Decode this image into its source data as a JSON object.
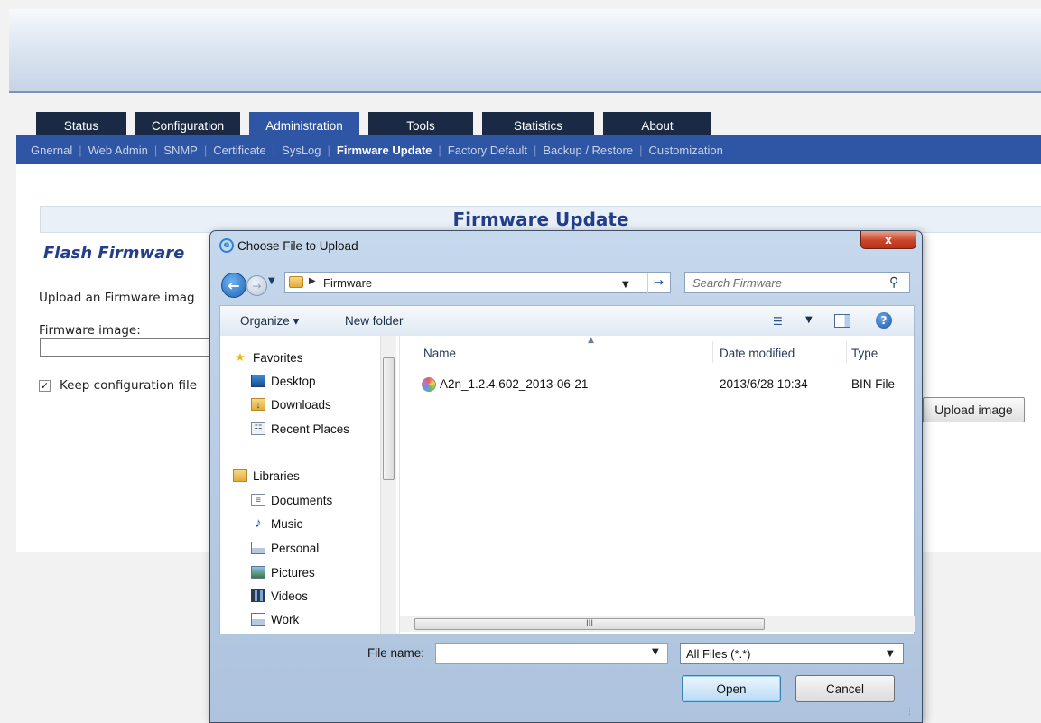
{
  "tabs": [
    "Status",
    "Configuration",
    "Administration",
    "Tools",
    "Statistics",
    "About"
  ],
  "active_tab": "Administration",
  "subnav": [
    "Gnernal",
    "Web Admin",
    "SNMP",
    "Certificate",
    "SysLog",
    "Firmware Update",
    "Factory Default",
    "Backup / Restore",
    "Customization"
  ],
  "page": {
    "section_title": "Firmware Update",
    "flash_title": "Flash Firmware",
    "upload_desc": "Upload an Firmware imag",
    "fw_label": "Firmware image:",
    "keep_label": "Keep configuration file",
    "keep_checked": "✓",
    "upload_button": "Upload image"
  },
  "dialog": {
    "title": "Choose File to Upload",
    "close": "x",
    "address": "Firmware",
    "search_placeholder": "Search Firmware",
    "organize": "Organize ▾",
    "new_folder": "New folder",
    "nav": {
      "favorites": "Favorites",
      "desktop": "Desktop",
      "downloads": "Downloads",
      "recent": "Recent Places",
      "libraries": "Libraries",
      "documents": "Documents",
      "music": "Music",
      "personal": "Personal",
      "pictures": "Pictures",
      "videos": "Videos",
      "work": "Work"
    },
    "columns": {
      "name": "Name",
      "date": "Date modified",
      "type": "Type"
    },
    "files": [
      {
        "name": "A2n_1.2.4.602_2013-06-21",
        "date": "2013/6/28 10:34",
        "type": "BIN File"
      }
    ],
    "filename_label": "File name:",
    "filename_value": "",
    "filetype": "All Files (*.*)",
    "open": "Open",
    "cancel": "Cancel",
    "hscroll_grip": "III"
  }
}
